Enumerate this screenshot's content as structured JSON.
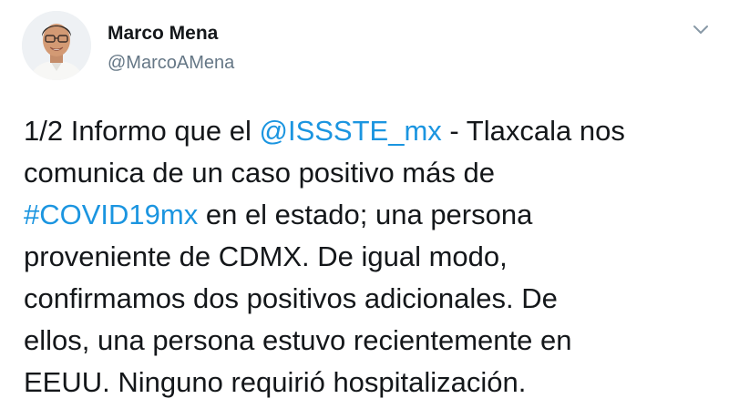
{
  "tweet": {
    "author": {
      "name": "Marco Mena",
      "handle": "@MarcoAMena",
      "avatar_icon": "profile-photo"
    },
    "menu_icon": "chevron-down-icon",
    "body": {
      "line1": {
        "a": "1/2 Informo que el ",
        "mention": "@ISSSTE_mx",
        "b": " - Tlaxcala nos"
      },
      "line2": "comunica de un caso positivo más de",
      "line3": {
        "hashtag": "#COVID19mx",
        "b": " en el estado; una persona"
      },
      "line4": "proveniente de CDMX. De igual modo,",
      "line5": "confirmamos dos positivos adicionales. De",
      "line6": "ellos, una persona estuvo recientemente en",
      "line7": "EEUU. Ninguno requirió hospitalización."
    }
  },
  "colors": {
    "link": "#1b95e0",
    "text": "#14171a",
    "secondary": "#657786"
  }
}
